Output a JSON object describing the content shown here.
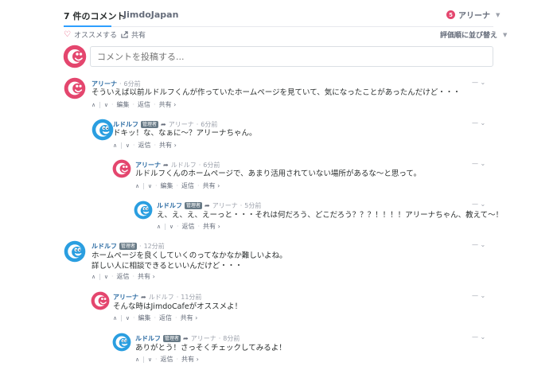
{
  "header": {
    "comments_tab": "7 件のコメント",
    "site_tab": "JimdoJapan",
    "notification_count": "5",
    "user_name": "アリーナ"
  },
  "actions": {
    "recommend": "オススメする",
    "share": "共有",
    "sort": "評価順に並び替え"
  },
  "composer": {
    "placeholder": "コメントを投稿する..."
  },
  "labels": {
    "mod_badge": "管理者",
    "edit": "編集",
    "reply": "返信",
    "share": "共有 ›",
    "dash": "—",
    "menu_caret": "⌄"
  },
  "comments": [
    {
      "author": "アリーナ",
      "time": "6分前",
      "body": [
        "そういえば以前ルドルフくんが作っていたホームページを見ていて、気になったことがあったんだけど・・・"
      ]
    },
    {
      "author": "ルドルフ",
      "parent": "アリーナ",
      "time": "6分前",
      "body": [
        "ドキッ！な、なぁに～？アリーナちゃん。"
      ]
    },
    {
      "author": "アリーナ",
      "parent": "ルドルフ",
      "time": "6分前",
      "body": [
        "ルドルフくんのホームページで、あまり活用されていない場所があるな～と思って。"
      ]
    },
    {
      "author": "ルドルフ",
      "parent": "アリーナ",
      "time": "5分前",
      "body": [
        "え、え、え、えーっと・・・それは何だろう、どこだろう？？？！！！！アリーナちゃん、教えて～！"
      ]
    },
    {
      "author": "ルドルフ",
      "time": "12分前",
      "body": [
        "ホームページを良くしていくのってなかなか難しいよね。",
        "詳しい人に相談できるといいんだけど・・・"
      ]
    },
    {
      "author": "アリーナ",
      "parent": "ルドルフ",
      "time": "11分前",
      "body": [
        "そんな時はJimdoCafeがオススメよ！"
      ]
    },
    {
      "author": "ルドルフ",
      "parent": "アリーナ",
      "time": "8分前",
      "body": [
        "ありがとう！さっそくチェックしてみるよ！"
      ]
    }
  ],
  "colors": {
    "arina_pink": "#e4466e",
    "rudolf_blue": "#2a9ee0",
    "link_blue": "#2e6da4",
    "tab_accent": "#2e9fff"
  }
}
